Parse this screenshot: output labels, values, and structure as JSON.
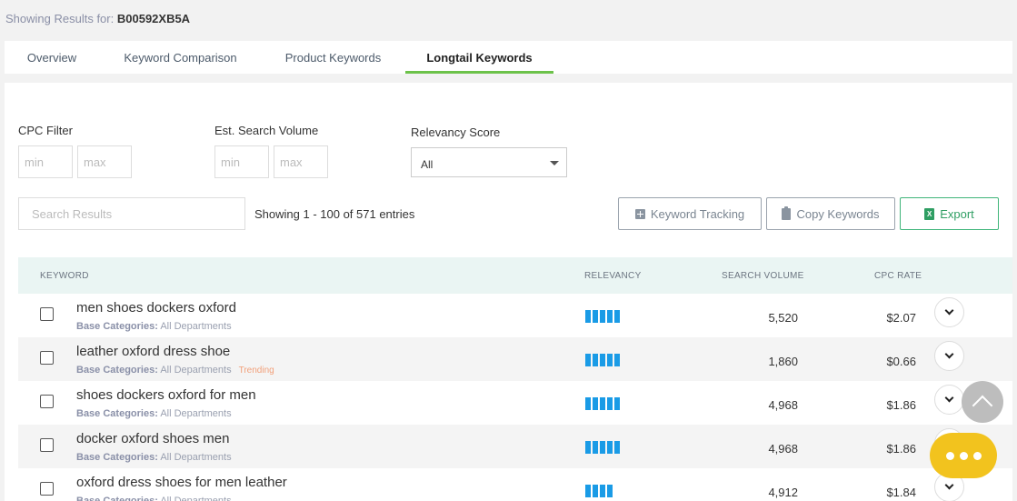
{
  "header": {
    "showing_label": "Showing Results for:",
    "asin": "B00592XB5A"
  },
  "tabs": [
    {
      "label": "Overview",
      "active": false
    },
    {
      "label": "Keyword Comparison",
      "active": false
    },
    {
      "label": "Product Keywords",
      "active": false
    },
    {
      "label": "Longtail Keywords",
      "active": true
    }
  ],
  "filters": {
    "cpc": {
      "label": "CPC Filter",
      "min_placeholder": "min",
      "max_placeholder": "max"
    },
    "volume": {
      "label": "Est. Search Volume",
      "min_placeholder": "min",
      "max_placeholder": "max"
    },
    "relevancy": {
      "label": "Relevancy Score",
      "selected": "All"
    }
  },
  "search": {
    "placeholder": "Search Results"
  },
  "entries_text": "Showing 1 - 100 of 571 entries",
  "buttons": {
    "tracking": "Keyword Tracking",
    "copy": "Copy Keywords",
    "export": "Export"
  },
  "table": {
    "headers": {
      "keyword": "KEYWORD",
      "relevancy": "RELEVANCY",
      "volume": "SEARCH VOLUME",
      "cpc": "CPC RATE"
    },
    "category_label": "Base Categories:",
    "rows": [
      {
        "keyword": "men shoes dockers oxford",
        "category": "All Departments",
        "trending": "",
        "relevancy_bars": 5,
        "volume": "5,520",
        "cpc": "$2.07"
      },
      {
        "keyword": "leather oxford dress shoe",
        "category": "All Departments",
        "trending": "Trending",
        "relevancy_bars": 5,
        "volume": "1,860",
        "cpc": "$0.66"
      },
      {
        "keyword": "shoes dockers oxford for men",
        "category": "All Departments",
        "trending": "",
        "relevancy_bars": 5,
        "volume": "4,968",
        "cpc": "$1.86"
      },
      {
        "keyword": "docker oxford shoes men",
        "category": "All Departments",
        "trending": "",
        "relevancy_bars": 5,
        "volume": "4,968",
        "cpc": "$1.86"
      },
      {
        "keyword": "oxford dress shoes for men leather",
        "category": "All Departments",
        "trending": "",
        "relevancy_bars": 4,
        "volume": "4,912",
        "cpc": "$1.84"
      }
    ]
  },
  "colors": {
    "accent_tab": "#6cc24a",
    "bar": "#1a9be6",
    "export": "#2f9e63",
    "chat": "#f2c31e",
    "trending": "#f2a07a"
  }
}
